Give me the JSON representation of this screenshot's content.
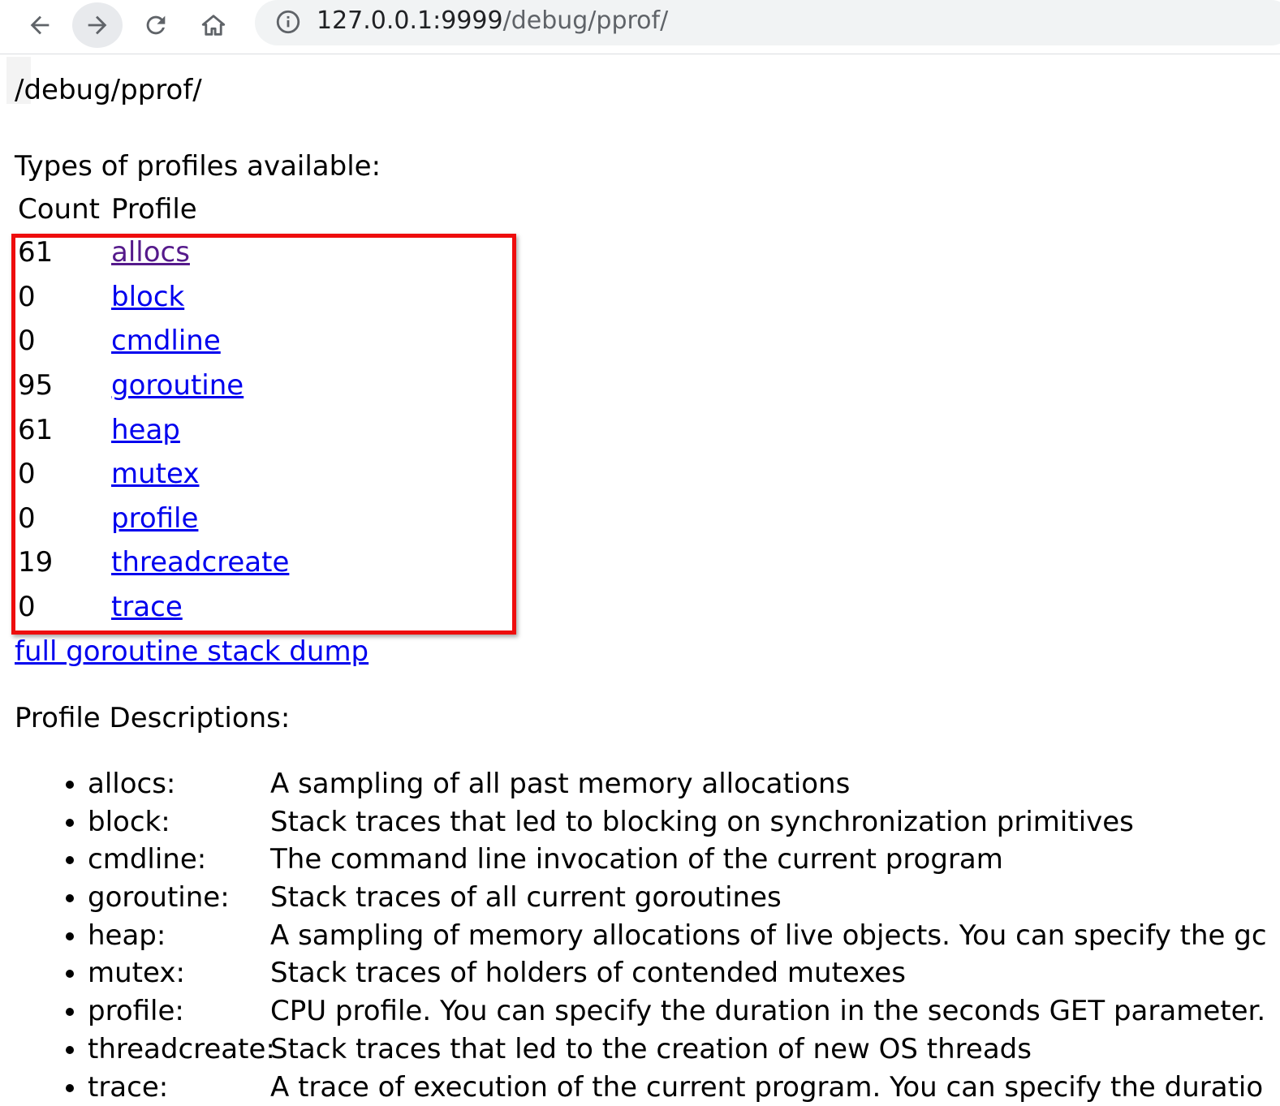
{
  "browser": {
    "url_host": "127.0.0.1:9999",
    "url_path": "/debug/pprof/",
    "icons": [
      "back-icon",
      "forward-icon",
      "reload-icon",
      "home-icon",
      "info-icon"
    ]
  },
  "page": {
    "title": "/debug/pprof/",
    "types_heading": "Types of profiles available:",
    "table": {
      "headers": [
        "Count",
        "Profile"
      ],
      "rows": [
        {
          "count": "61",
          "profile": "allocs",
          "visited": true
        },
        {
          "count": "0",
          "profile": "block"
        },
        {
          "count": "0",
          "profile": "cmdline"
        },
        {
          "count": "95",
          "profile": "goroutine"
        },
        {
          "count": "61",
          "profile": "heap"
        },
        {
          "count": "0",
          "profile": "mutex"
        },
        {
          "count": "0",
          "profile": "profile"
        },
        {
          "count": "19",
          "profile": "threadcreate"
        },
        {
          "count": "0",
          "profile": "trace"
        }
      ]
    },
    "full_dump_link": "full goroutine stack dump",
    "descriptions_heading": "Profile Descriptions:",
    "descriptions": [
      {
        "name": "allocs:",
        "text": "A sampling of all past memory allocations"
      },
      {
        "name": "block:",
        "text": "Stack traces that led to blocking on synchronization primitives"
      },
      {
        "name": "cmdline:",
        "text": "The command line invocation of the current program"
      },
      {
        "name": "goroutine:",
        "text": "Stack traces of all current goroutines"
      },
      {
        "name": "heap:",
        "text": "A sampling of memory allocations of live objects. You can specify the gc"
      },
      {
        "name": "mutex:",
        "text": "Stack traces of holders of contended mutexes"
      },
      {
        "name": "profile:",
        "text": "CPU profile. You can specify the duration in the seconds GET parameter."
      },
      {
        "name": "threadcreate:",
        "text": "Stack traces that led to the creation of new OS threads"
      },
      {
        "name": "trace:",
        "text": "A trace of execution of the current program. You can specify the duratio"
      }
    ]
  },
  "colors": {
    "link": "#0000ee",
    "visited_link": "#551a8b",
    "highlight_box": "#ee0d0d",
    "omnibox_bg": "#f1f3f4"
  }
}
